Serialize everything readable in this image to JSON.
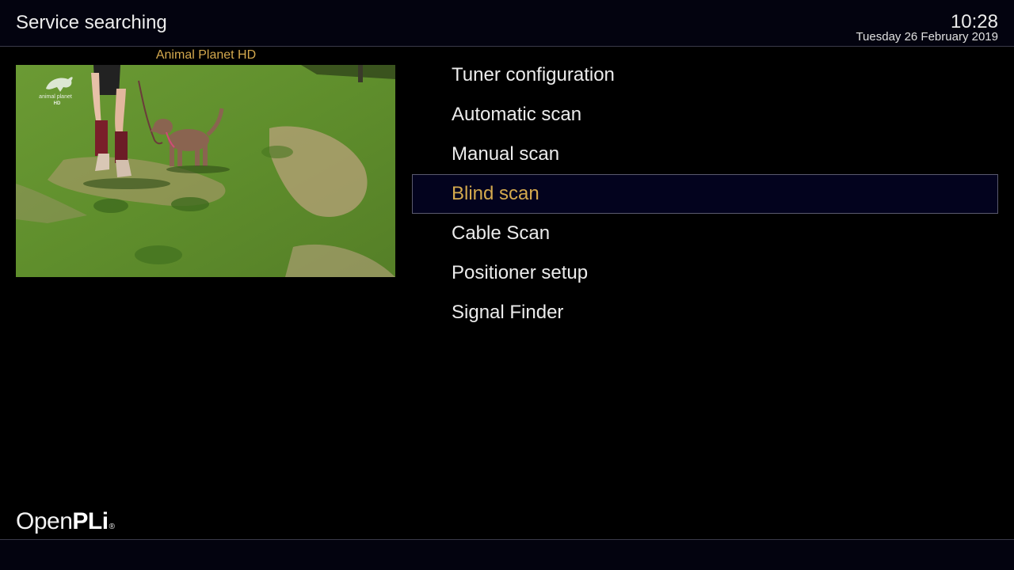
{
  "header": {
    "title": "Service searching",
    "clock": "10:28",
    "date": "Tuesday 26 February 2019"
  },
  "preview": {
    "channel_name": "Animal Planet HD",
    "watermark_text": "animal planet",
    "watermark_sub": "HD"
  },
  "menu": {
    "selected_index": 3,
    "items": [
      {
        "label": "Tuner configuration"
      },
      {
        "label": "Automatic scan"
      },
      {
        "label": "Manual scan"
      },
      {
        "label": "Blind scan"
      },
      {
        "label": "Cable Scan"
      },
      {
        "label": "Positioner setup"
      },
      {
        "label": "Signal Finder"
      }
    ]
  },
  "logo": {
    "part_light": "Open",
    "part_bold": "PLi",
    "reg_mark": "®"
  },
  "colors": {
    "accent": "#d4a94e",
    "header_bg": "#03030f",
    "selection_bg": "#03031e",
    "text": "#ececec"
  }
}
